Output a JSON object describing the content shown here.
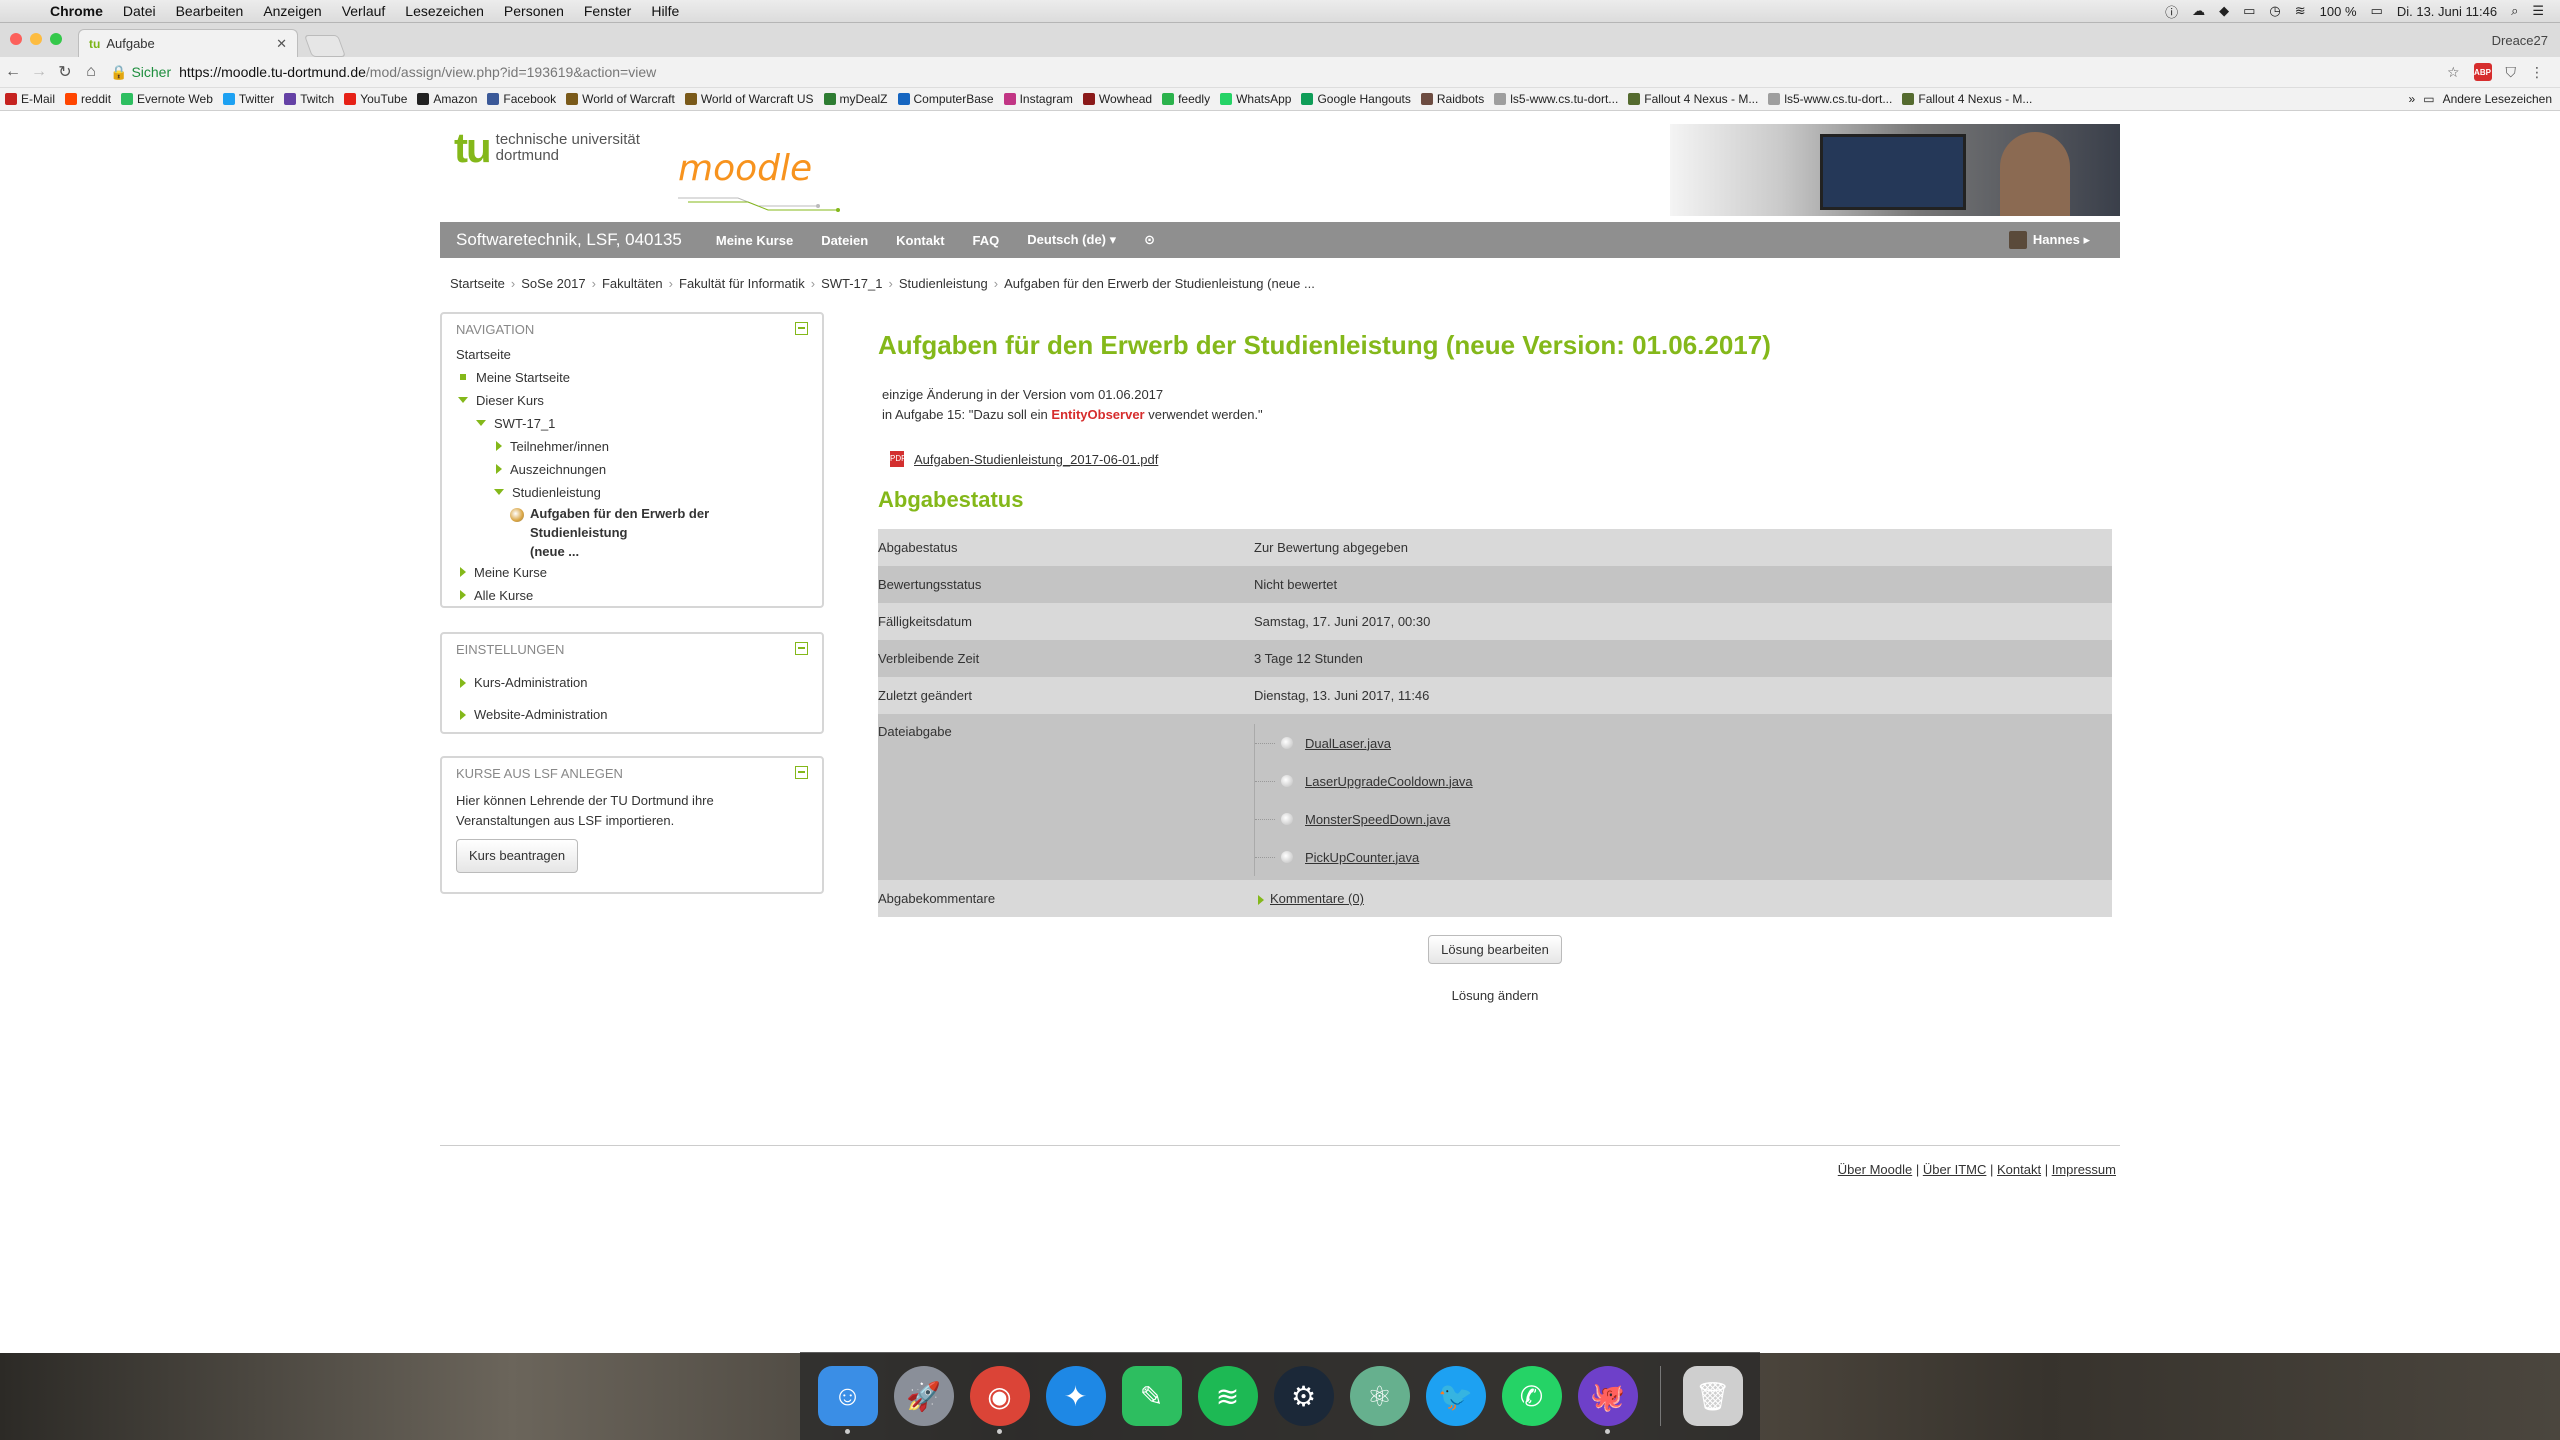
{
  "menubar": {
    "app": "Chrome",
    "items": [
      "Datei",
      "Bearbeiten",
      "Anzeigen",
      "Verlauf",
      "Lesezeichen",
      "Personen",
      "Fenster",
      "Hilfe"
    ],
    "battery": "100 %",
    "datetime": "Di. 13. Juni  11:46"
  },
  "browser": {
    "tab_title": "Aufgabe",
    "tab_favicon": "tu",
    "profile": "Dreace27",
    "secure_label": "Sicher",
    "url_host": "https://moodle.tu-dortmund.de",
    "url_path": "/mod/assign/view.php?id=193619&action=view",
    "bookmarks": [
      {
        "label": "E-Mail",
        "color": "#c5221f",
        "icon": "mail-icon"
      },
      {
        "label": "reddit",
        "color": "#ff4500",
        "icon": "reddit-icon"
      },
      {
        "label": "Evernote Web",
        "color": "#2dbe60",
        "icon": "evernote-icon"
      },
      {
        "label": "Twitter",
        "color": "#1da1f2",
        "icon": "twitter-icon"
      },
      {
        "label": "Twitch",
        "color": "#6441a5",
        "icon": "twitch-icon"
      },
      {
        "label": "YouTube",
        "color": "#e62117",
        "icon": "youtube-icon"
      },
      {
        "label": "Amazon",
        "color": "#222222",
        "icon": "amazon-icon"
      },
      {
        "label": "Facebook",
        "color": "#3b5998",
        "icon": "facebook-icon"
      },
      {
        "label": "World of Warcraft",
        "color": "#7a5a1a",
        "icon": "wow-icon"
      },
      {
        "label": "World of Warcraft US",
        "color": "#7a5a1a",
        "icon": "wow-icon"
      },
      {
        "label": "myDealZ",
        "color": "#2e7d32",
        "icon": "mydealz-icon"
      },
      {
        "label": "ComputerBase",
        "color": "#1565c0",
        "icon": "computerbase-icon"
      },
      {
        "label": "Instagram",
        "color": "#c13584",
        "icon": "instagram-icon"
      },
      {
        "label": "Wowhead",
        "color": "#8b1a1a",
        "icon": "wowhead-icon"
      },
      {
        "label": "feedly",
        "color": "#2bb24c",
        "icon": "feedly-icon"
      },
      {
        "label": "WhatsApp",
        "color": "#25d366",
        "icon": "whatsapp-icon"
      },
      {
        "label": "Google Hangouts",
        "color": "#0f9d58",
        "icon": "hangouts-icon"
      },
      {
        "label": "Raidbots",
        "color": "#6d4c41",
        "icon": "raidbots-icon"
      },
      {
        "label": "ls5-www.cs.tu-dort...",
        "color": "#9e9e9e",
        "icon": "page-icon"
      },
      {
        "label": "Fallout 4 Nexus - M...",
        "color": "#556b2f",
        "icon": "nexus-icon"
      },
      {
        "label": "ls5-www.cs.tu-dort...",
        "color": "#9e9e9e",
        "icon": "page-icon"
      },
      {
        "label": "Fallout 4 Nexus - M...",
        "color": "#556b2f",
        "icon": "nexus-icon"
      }
    ],
    "other_bookmarks": "Andere Lesezeichen"
  },
  "site": {
    "tu_mark": "tu",
    "tu_line1": "technische universität",
    "tu_line2": "dortmund",
    "moodle": "moodle",
    "course_brand": "Softwaretechnik, LSF, 040135",
    "nav": [
      "Meine Kurse",
      "Dateien",
      "Kontakt",
      "FAQ",
      "Deutsch (de) ▾",
      "⊙"
    ],
    "user": "Hannes ▸"
  },
  "breadcrumb": [
    "Startseite",
    "SoSe 2017",
    "Fakultäten",
    "Fakultät für Informatik",
    "SWT-17_1",
    "Studienleistung",
    "Aufgaben für den Erwerb der Studienleistung (neue ..."
  ],
  "navigation": {
    "title": "NAVIGATION",
    "home": "Startseite",
    "my_home": "Meine Startseite",
    "this_course": "Dieser Kurs",
    "course": "SWT-17_1",
    "participants": "Teilnehmer/innen",
    "badges": "Auszeichnungen",
    "section": "Studienleistung",
    "current_line1": "Aufgaben für den Erwerb der Studienleistung",
    "current_line2": "(neue ...",
    "my_courses": "Meine Kurse",
    "all_courses": "Alle Kurse"
  },
  "settings": {
    "title": "EINSTELLUNGEN",
    "course_admin": "Kurs-Administration",
    "site_admin": "Website-Administration"
  },
  "lsf": {
    "title": "KURSE AUS LSF ANLEGEN",
    "text_line1": "Hier können Lehrende der TU Dortmund ihre",
    "text_line2": "Veranstaltungen aus LSF importieren.",
    "button": "Kurs beantragen"
  },
  "main": {
    "title": "Aufgaben für den Erwerb der Studienleistung (neue Version: 01.06.2017)",
    "intro_line1": "einzige Änderung in der Version vom 01.06.2017",
    "intro_line2_pre": "in Aufgabe 15: \"Dazu soll ein ",
    "intro_line2_hl": "EntityObserver",
    "intro_line2_post": " verwendet werden.\"",
    "pdf": "Aufgaben-Studienleistung_2017-06-01.pdf",
    "status_heading": "Abgabestatus",
    "rows": [
      {
        "label": "Abgabestatus",
        "value": "Zur Bewertung abgegeben"
      },
      {
        "label": "Bewertungsstatus",
        "value": "Nicht bewertet"
      },
      {
        "label": "Fälligkeitsdatum",
        "value": "Samstag, 17. Juni 2017, 00:30"
      },
      {
        "label": "Verbleibende Zeit",
        "value": "3 Tage 12 Stunden"
      },
      {
        "label": "Zuletzt geändert",
        "value": "Dienstag, 13. Juni 2017, 11:46"
      }
    ],
    "files_label": "Dateiabgabe",
    "files": [
      "DualLaser.java",
      "LaserUpgradeCooldown.java",
      "MonsterSpeedDown.java",
      "PickUpCounter.java"
    ],
    "comments_label": "Abgabekommentare",
    "comments_link": "Kommentare (0)",
    "edit_button": "Lösung bearbeiten",
    "edit_hint": "Lösung ändern"
  },
  "footer": {
    "links": [
      "Über Moodle",
      "Über ITMC",
      "Kontakt",
      "Impressum"
    ]
  },
  "dock": [
    {
      "name": "finder",
      "color": "#3a8ee6",
      "glyph": "☺",
      "running": true
    },
    {
      "name": "launchpad",
      "color": "#8a8f99",
      "glyph": "🚀",
      "running": false
    },
    {
      "name": "chrome",
      "color": "#db4437",
      "glyph": "◉",
      "running": true
    },
    {
      "name": "safari",
      "color": "#1e88e5",
      "glyph": "✦",
      "running": false
    },
    {
      "name": "evernote",
      "color": "#2dbe60",
      "glyph": "✎",
      "running": false
    },
    {
      "name": "spotify",
      "color": "#1db954",
      "glyph": "≋",
      "running": false
    },
    {
      "name": "steam",
      "color": "#1b2838",
      "glyph": "⚙",
      "running": false
    },
    {
      "name": "atom",
      "color": "#66b08e",
      "glyph": "⚛",
      "running": false
    },
    {
      "name": "twitter",
      "color": "#1da1f2",
      "glyph": "🐦",
      "running": false
    },
    {
      "name": "whatsapp",
      "color": "#25d366",
      "glyph": "✆",
      "running": false
    },
    {
      "name": "github",
      "color": "#6e40c9",
      "glyph": "🐙",
      "running": true
    },
    {
      "name": "trash",
      "color": "#cfcfcf",
      "glyph": "🗑",
      "running": false
    }
  ]
}
